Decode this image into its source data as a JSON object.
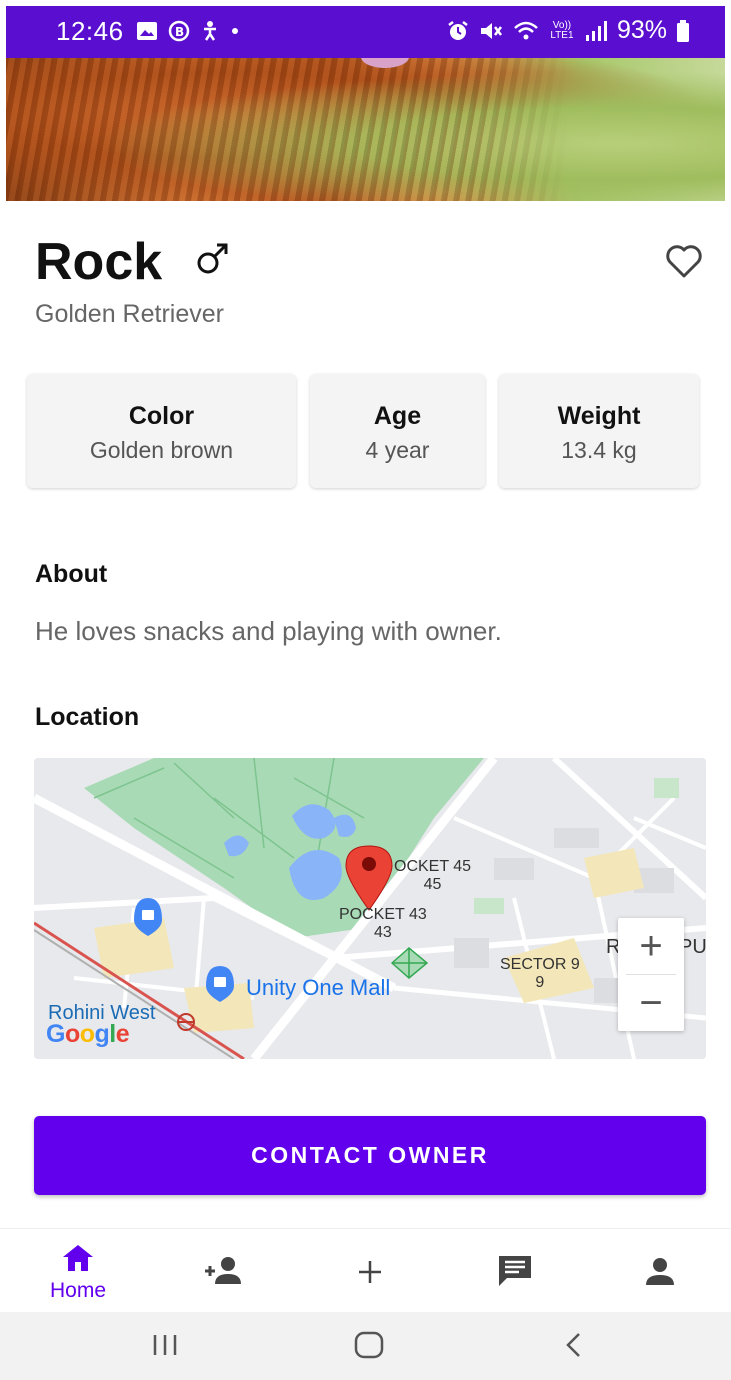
{
  "status_bar": {
    "time": "12:46",
    "battery": "93%",
    "icons": [
      "gallery-icon",
      "bixby-icon",
      "accessibility-icon",
      "dot-icon",
      "alarm-icon",
      "mute-icon",
      "wifi-icon",
      "volte-icon",
      "signal-icon",
      "battery-icon"
    ],
    "volte_text": "Vo)) LTE1",
    "background_color": "#5a0fd0"
  },
  "pet": {
    "name": "Rock",
    "gender_symbol": "♂",
    "breed": "Golden Retriever"
  },
  "stats": [
    {
      "title": "Color",
      "value": "Golden brown"
    },
    {
      "title": "Age",
      "value": "4 year"
    },
    {
      "title": "Weight",
      "value": "13.4 kg"
    }
  ],
  "about": {
    "heading": "About",
    "text": "He loves snacks and playing with owner."
  },
  "location": {
    "heading": "Location",
    "map_labels": {
      "pocket45_line1": "OCKET 45",
      "pocket45_line2": "45",
      "pocket43_line1": "POCKET 43",
      "pocket43_line2": "43",
      "sector9_line1": "SECTOR 9",
      "sector9_line2": "9",
      "rajapur": "RA",
      "rajapur_tail": "PUF",
      "mall": "Unity One Mall",
      "rohini": "Rohini West",
      "google": "Google"
    },
    "zoom_in": "+",
    "zoom_out": "−"
  },
  "contact_button": {
    "label": "CONTACT OWNER"
  },
  "bottom_nav": {
    "items": [
      {
        "icon": "home-icon",
        "label": "Home",
        "active": true
      },
      {
        "icon": "add-friend-icon",
        "label": ""
      },
      {
        "icon": "plus-icon",
        "label": ""
      },
      {
        "icon": "chat-icon",
        "label": ""
      },
      {
        "icon": "profile-icon",
        "label": ""
      }
    ]
  },
  "system_nav": {
    "buttons": [
      "recents-icon",
      "home-circle-icon",
      "back-icon"
    ]
  },
  "colors": {
    "accent": "#6200ee",
    "map_park": "#a8dab5",
    "map_water": "#8ab4f8",
    "pin": "#ea4335"
  }
}
